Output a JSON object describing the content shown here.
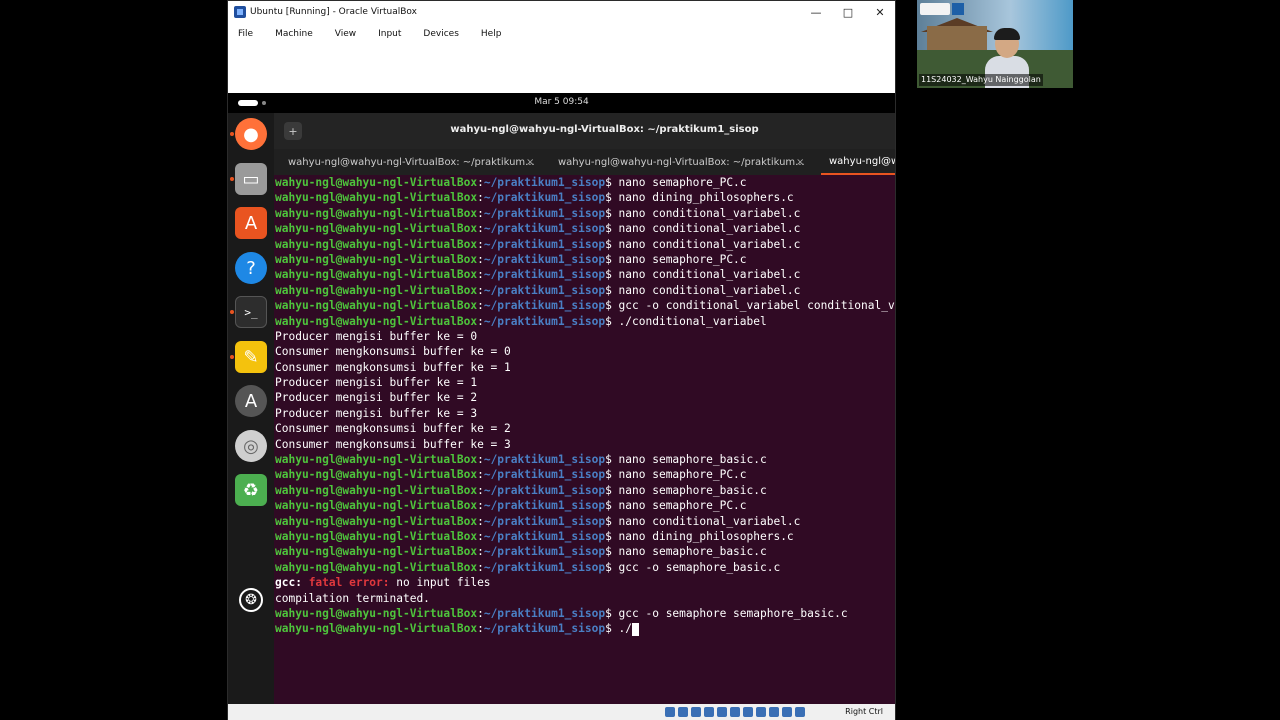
{
  "window": {
    "title": "Ubuntu [Running] - Oracle VirtualBox",
    "minimize_glyph": "—",
    "maximize_glyph": "□",
    "close_glyph": "✕"
  },
  "menu": [
    "File",
    "Machine",
    "View",
    "Input",
    "Devices",
    "Help"
  ],
  "guest_topbar": {
    "clock": "Mar 5  09:54"
  },
  "dock": {
    "items": [
      {
        "name": "firefox-icon",
        "glyph": "●",
        "color": "#ff7139",
        "running": true
      },
      {
        "name": "files-icon",
        "glyph": "▭",
        "color": "#9a9a9a",
        "running": true
      },
      {
        "name": "software-center-icon",
        "glyph": "A",
        "color": "#e95420",
        "running": false
      },
      {
        "name": "help-icon",
        "glyph": "?",
        "color": "#1e88e5",
        "running": false
      },
      {
        "name": "terminal-icon",
        "glyph": ">_",
        "color": "#2d2d2d",
        "running": true
      },
      {
        "name": "text-editor-icon",
        "glyph": "✎",
        "color": "#f4c20d",
        "running": true
      },
      {
        "name": "software-updater-icon",
        "glyph": "A",
        "color": "#555555",
        "running": false
      },
      {
        "name": "dvd-icon",
        "glyph": "◎",
        "color": "#cfcfcf",
        "running": false
      },
      {
        "name": "trash-icon",
        "glyph": "♻",
        "color": "#4caf50",
        "running": false
      },
      {
        "name": "show-apps-icon",
        "glyph": "❂",
        "color": "#1a1a1a",
        "running": false
      }
    ]
  },
  "terminal": {
    "title": "wahyu-ngl@wahyu-ngl-VirtualBox: ~/praktikum1_sisop",
    "newtab_glyph": "+",
    "tabs": [
      {
        "label": "wahyu-ngl@wahyu-ngl-VirtualBox: ~/praktikum...",
        "close": "×"
      },
      {
        "label": "wahyu-ngl@wahyu-ngl-VirtualBox: ~/praktikum...",
        "close": "×"
      },
      {
        "label": "wahyu-ngl@wahyu-ngl-VirtualBox: ~/praktikum...",
        "close": ""
      }
    ],
    "user": "wahyu-ngl@wahyu-ngl-VirtualBox",
    "path": "~/praktikum1_sisop",
    "lines": [
      {
        "type": "cmd",
        "text": "nano semaphore_PC.c"
      },
      {
        "type": "cmd",
        "text": "nano dining_philosophers.c"
      },
      {
        "type": "cmd",
        "text": "nano conditional_variabel.c"
      },
      {
        "type": "cmd",
        "text": "nano conditional_variabel.c"
      },
      {
        "type": "cmd",
        "text": "nano conditional_variabel.c"
      },
      {
        "type": "cmd",
        "text": "nano semaphore_PC.c"
      },
      {
        "type": "cmd",
        "text": "nano conditional_variabel.c"
      },
      {
        "type": "cmd",
        "text": "nano conditional_variabel.c"
      },
      {
        "type": "cmd",
        "text": "gcc -o conditional_variabel conditional_variabel.c"
      },
      {
        "type": "cmd",
        "text": "./conditional_variabel"
      },
      {
        "type": "out",
        "text": "Producer mengisi buffer ke = 0"
      },
      {
        "type": "out",
        "text": "Consumer mengkonsumsi buffer ke = 0"
      },
      {
        "type": "out",
        "text": "Consumer mengkonsumsi buffer ke = 1"
      },
      {
        "type": "out",
        "text": "Producer mengisi buffer ke = 1"
      },
      {
        "type": "out",
        "text": "Producer mengisi buffer ke = 2"
      },
      {
        "type": "out",
        "text": "Producer mengisi buffer ke = 3"
      },
      {
        "type": "out",
        "text": "Consumer mengkonsumsi buffer ke = 2"
      },
      {
        "type": "out",
        "text": "Consumer mengkonsumsi buffer ke = 3"
      },
      {
        "type": "cmd",
        "text": "nano semaphore_basic.c"
      },
      {
        "type": "cmd",
        "text": "nano semaphore_PC.c"
      },
      {
        "type": "cmd",
        "text": "nano semaphore_basic.c"
      },
      {
        "type": "cmd",
        "text": "nano semaphore_PC.c"
      },
      {
        "type": "cmd",
        "text": "nano conditional_variabel.c"
      },
      {
        "type": "cmd",
        "text": "nano dining_philosophers.c"
      },
      {
        "type": "cmd",
        "text": "nano semaphore_basic.c"
      },
      {
        "type": "cmd",
        "text": "gcc -o semaphore_basic.c"
      },
      {
        "type": "err",
        "prefix": "gcc:",
        "label": "fatal error:",
        "text": "no input files"
      },
      {
        "type": "out",
        "text": "compilation terminated."
      },
      {
        "type": "cmd",
        "text": "gcc -o semaphore semaphore_basic.c"
      },
      {
        "type": "cmd",
        "text": "./",
        "cursor": true
      }
    ]
  },
  "statusbar": {
    "host_key": "Right Ctrl"
  },
  "webcam": {
    "caption": "11S24032_Wahyu Nainggolan"
  },
  "colors": {
    "terminal_bg": "#300a24",
    "prompt_user": "#4ec43c",
    "prompt_path": "#4a7fc4",
    "error": "#e0383d",
    "accent": "#e95420"
  }
}
